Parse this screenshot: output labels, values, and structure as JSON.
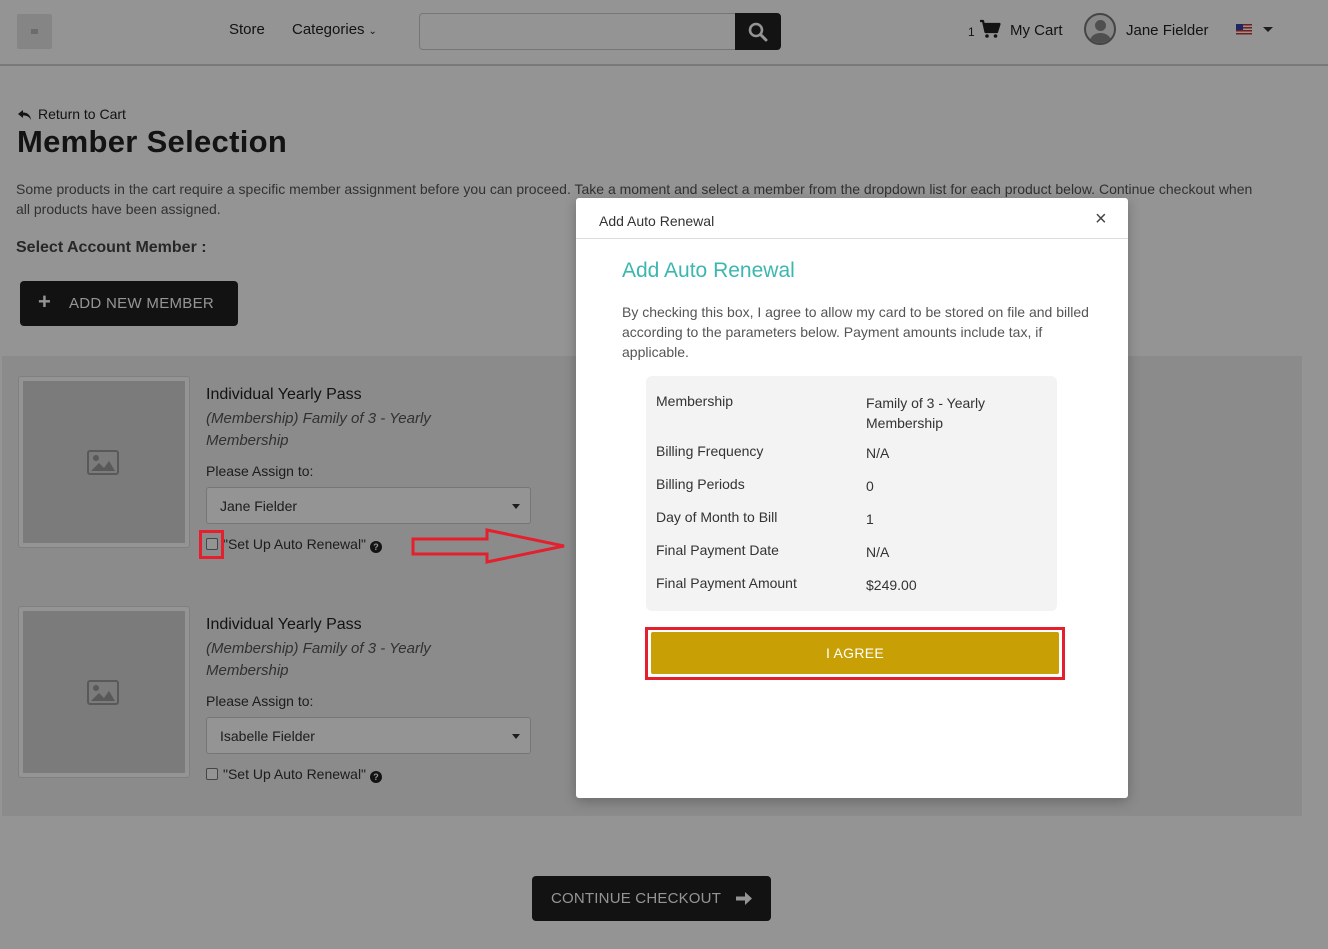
{
  "header": {
    "nav_store": "Store",
    "nav_categories": "Categories",
    "search_placeholder": "",
    "cart_count": "1",
    "cart_label": "My Cart",
    "user_name": "Jane Fielder"
  },
  "page": {
    "return_link": "Return to Cart",
    "title": "Member Selection",
    "intro": "Some products in the cart require a specific member assignment before you can proceed. Take a moment and select a member from the dropdown list for each product below. Continue checkout when all products have been assigned.",
    "select_label": "Select Account Member :",
    "add_member_label": "ADD NEW MEMBER",
    "continue_label": "CONTINUE CHECKOUT"
  },
  "products": [
    {
      "title": "Individual Yearly Pass",
      "subtitle": "(Membership) Family of 3 - Yearly Membership",
      "assign_label": "Please Assign to:",
      "assigned_member": "Jane Fielder",
      "auto_renewal_label": "\"Set Up Auto Renewal\""
    },
    {
      "title": "Individual Yearly Pass",
      "subtitle": "(Membership) Family of 3 - Yearly Membership",
      "assign_label": "Please Assign to:",
      "assigned_member": "Isabelle Fielder",
      "auto_renewal_label": "\"Set Up Auto Renewal\""
    }
  ],
  "modal": {
    "header_title": "Add Auto Renewal",
    "close_glyph": "×",
    "title": "Add Auto Renewal",
    "text": "By checking this box, I agree to allow my card to be stored on file and billed according to the parameters below. Payment amounts include tax, if applicable.",
    "details": [
      {
        "label": "Membership",
        "value": "Family of 3 - Yearly Membership"
      },
      {
        "label": "Billing Frequency",
        "value": "N/A"
      },
      {
        "label": "Billing Periods",
        "value": "0"
      },
      {
        "label": "Day of Month to Bill",
        "value": "1"
      },
      {
        "label": "Final Payment Date",
        "value": "N/A"
      },
      {
        "label": "Final Payment Amount",
        "value": "$249.00"
      }
    ],
    "agree_label": "I AGREE"
  },
  "colors": {
    "accent_teal": "#3cb7b0",
    "agree_gold": "#c8a006",
    "annotation_red": "#e4202e",
    "button_dark": "#1f1f1f"
  },
  "icons": {
    "search": "search-icon",
    "cart": "cart-icon",
    "user": "user-avatar-icon",
    "flag": "us-flag-icon",
    "return": "reply-arrow-icon",
    "plus": "plus-icon",
    "image_placeholder": "image-icon",
    "help": "question-circle-icon",
    "arrow_right": "arrow-right-icon",
    "close": "close-icon"
  }
}
